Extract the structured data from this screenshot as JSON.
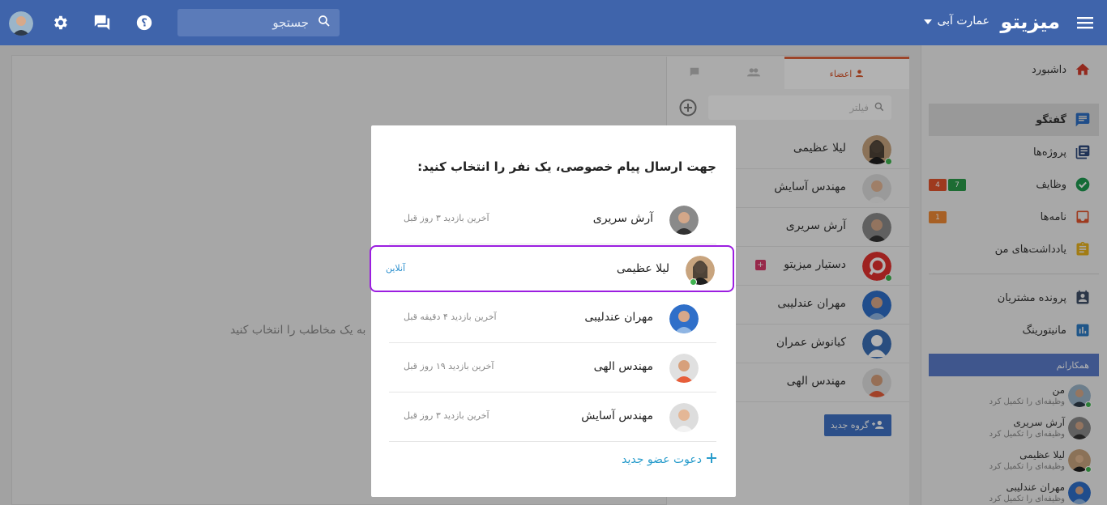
{
  "topbar": {
    "brand": "میزیتو",
    "company": "عمارت آبی",
    "search_placeholder": "جستجو"
  },
  "sidebar": {
    "items": [
      {
        "label": "داشبورد",
        "icon": "home-icon"
      },
      {
        "label": "گفتگو",
        "icon": "chat-icon",
        "active": true
      },
      {
        "label": "پروژه‌ها",
        "icon": "projects-icon"
      },
      {
        "label": "وظایف",
        "icon": "tasks-icon",
        "badges": [
          "7",
          "4"
        ]
      },
      {
        "label": "نامه‌ها",
        "icon": "mail-icon",
        "badges": [
          "1"
        ]
      },
      {
        "label": "یادداشت‌های من",
        "icon": "notes-icon"
      },
      {
        "label": "پرونده مشتریان",
        "icon": "contacts-icon"
      },
      {
        "label": "مانیتورینگ",
        "icon": "monitoring-icon"
      }
    ],
    "colleagues_title": "همکارانم",
    "colleagues": [
      {
        "name": "من",
        "status": "وظیفه‌ای را تکمیل کرد"
      },
      {
        "name": "آرش سریری",
        "status": "وظیفه‌ای را تکمیل کرد"
      },
      {
        "name": "لیلا عظیمی",
        "status": "وظیفه‌ای را تکمیل کرد"
      },
      {
        "name": "مهران عندلیبی",
        "status": "وظیفه‌ای را تکمیل کرد"
      }
    ]
  },
  "main": {
    "placeholder": "به یک مخاطب را انتخاب کنید"
  },
  "members_panel": {
    "tab_members": "اعضاء",
    "filter_placeholder": "فیلتر",
    "members": [
      "لیلا عظیمی",
      "مهندس آسایش",
      "آرش سریری",
      "دستیار میزیتو",
      "مهران عندلیبی",
      "کیانوش عمران",
      "مهندس الهی"
    ],
    "new_group": "گروه جدید"
  },
  "modal": {
    "title": "جهت ارسال پیام خصوصی، یک نفر را انتخاب کنید:",
    "people": [
      {
        "name": "آرش سریری",
        "last_seen": "آخرین بازدید ۳ روز قبل"
      },
      {
        "name": "لیلا عظیمی",
        "last_seen": "آنلاین"
      },
      {
        "name": "مهران عندلیبی",
        "last_seen": "آخرین بازدید ۴ دقیقه قبل"
      },
      {
        "name": "مهندس الهی",
        "last_seen": "آخرین بازدید ۱۹ روز قبل"
      },
      {
        "name": "مهندس آسایش",
        "last_seen": "آخرین بازدید ۳ روز قبل"
      }
    ],
    "invite": "دعوت عضو جدید"
  },
  "colors": {
    "topbar": "#3f64ab",
    "accent": "#2a9dcc",
    "selection": "#9b1ee0",
    "online": "#3fb34f"
  }
}
